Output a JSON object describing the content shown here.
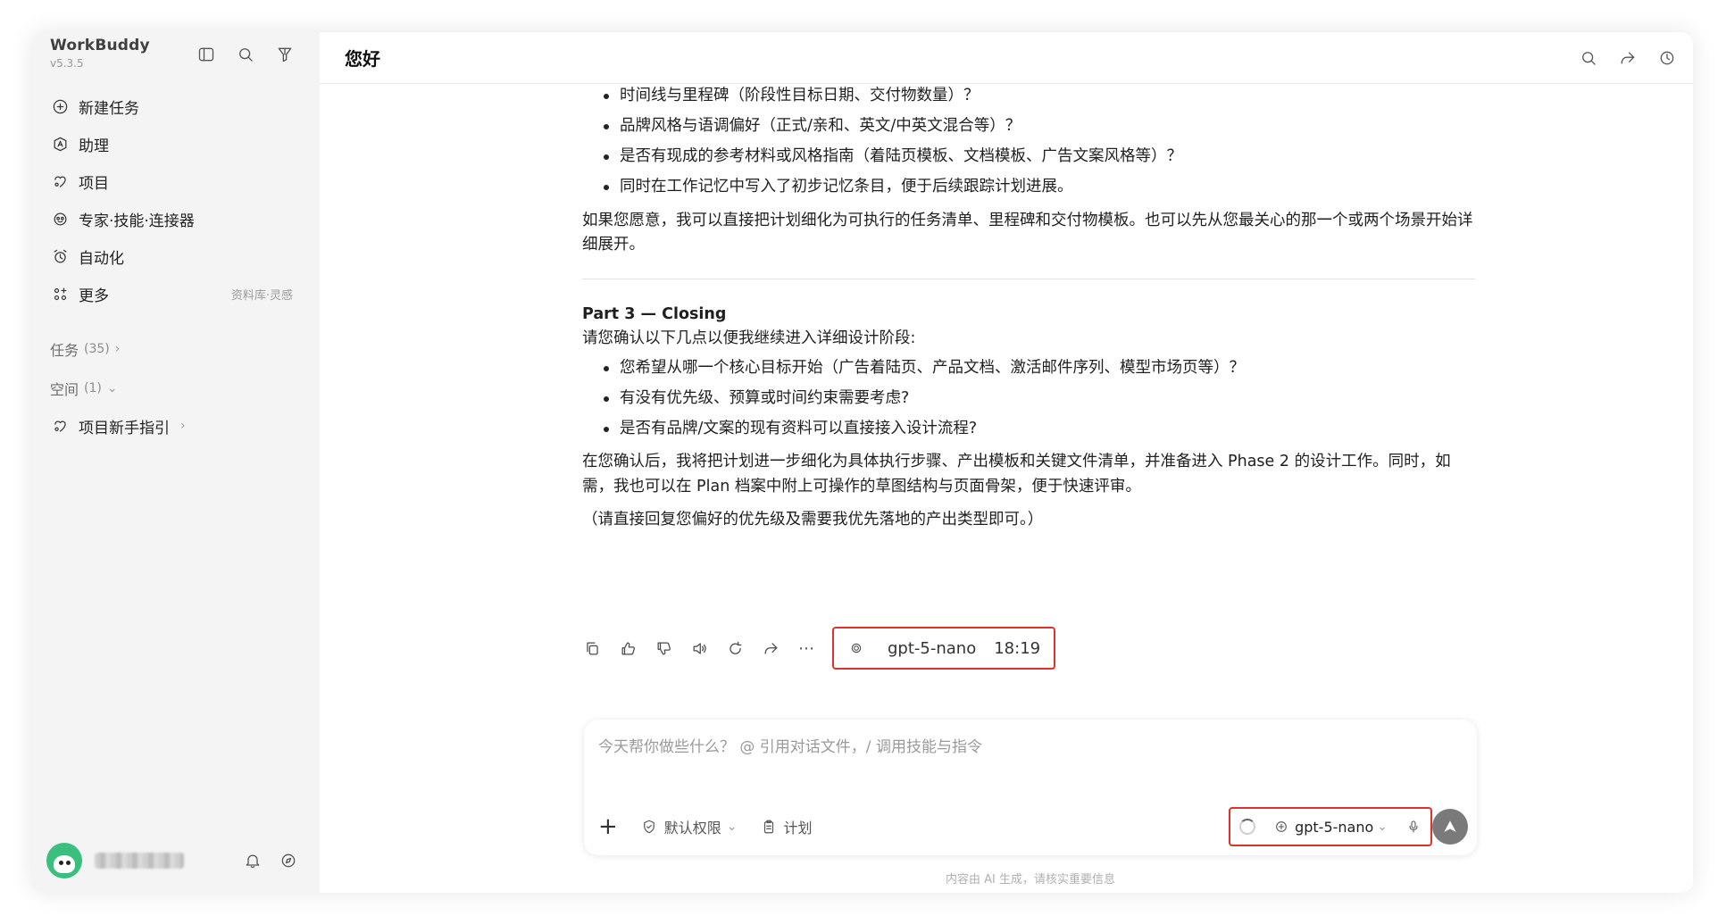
{
  "app": {
    "name": "WorkBuddy",
    "version": "v5.3.5"
  },
  "sidebar": {
    "items": [
      {
        "label": "新建任务",
        "icon": "plus-circle-icon"
      },
      {
        "label": "助理",
        "icon": "assistant-icon"
      },
      {
        "label": "项目",
        "icon": "project-icon"
      },
      {
        "label": "专家·技能·连接器",
        "icon": "expert-icon"
      },
      {
        "label": "自动化",
        "icon": "alarm-icon"
      },
      {
        "label": "更多",
        "icon": "grid-icon",
        "note": "资料库·灵感"
      }
    ],
    "tasks": {
      "label": "任务",
      "count": "(35)"
    },
    "spaces": {
      "label": "空间",
      "count": "(1)"
    },
    "space_items": [
      {
        "label": "项目新手指引"
      }
    ]
  },
  "header": {
    "title": "您好"
  },
  "message": {
    "bullets_top": [
      "时间线与里程碑（阶段性目标日期、交付物数量）？",
      "品牌风格与语调偏好（正式/亲和、英文/中英文混合等）？",
      "是否有现成的参考材料或风格指南（着陆页模板、文档模板、广告文案风格等）？",
      "同时在工作记忆中写入了初步记忆条目，便于后续跟踪计划进展。"
    ],
    "para1": "如果您愿意，我可以直接把计划细化为可执行的任务清单、里程碑和交付物模板。也可以先从您最关心的那一个或两个场景开始详细展开。",
    "part_title": "Part 3 — Closing",
    "intro": "请您确认以下几点以便我继续进入详细设计阶段:",
    "bullets_bottom": [
      "您希望从哪一个核心目标开始（广告着陆页、产品文档、激活邮件序列、模型市场页等）？",
      "有没有优先级、预算或时间约束需要考虑?",
      "是否有品牌/文案的现有资料可以直接接入设计流程?"
    ],
    "para2": "在您确认后，我将把计划进一步细化为具体执行步骤、产出模板和关键文件清单，并准备进入 Phase 2 的设计工作。同时，如需，我也可以在 Plan 档案中附上可操作的草图结构与页面骨架，便于快速评审。",
    "para3": "（请直接回复您偏好的优先级及需要我优先落地的产出类型即可。）",
    "model": "gpt-5-nano",
    "time": "18:19"
  },
  "composer": {
    "placeholder": "今天帮你做些什么？ @ 引用对话文件，/ 调用技能与指令",
    "permission": "默认权限",
    "plan": "计划",
    "model": "gpt-5-nano"
  },
  "footer": {
    "note": "内容由 AI 生成，请核实重要信息"
  },
  "colors": {
    "highlight": "#e0312b",
    "sidebar_bg": "#f4f4f4",
    "accent_avatar": "#3bbf7f"
  }
}
